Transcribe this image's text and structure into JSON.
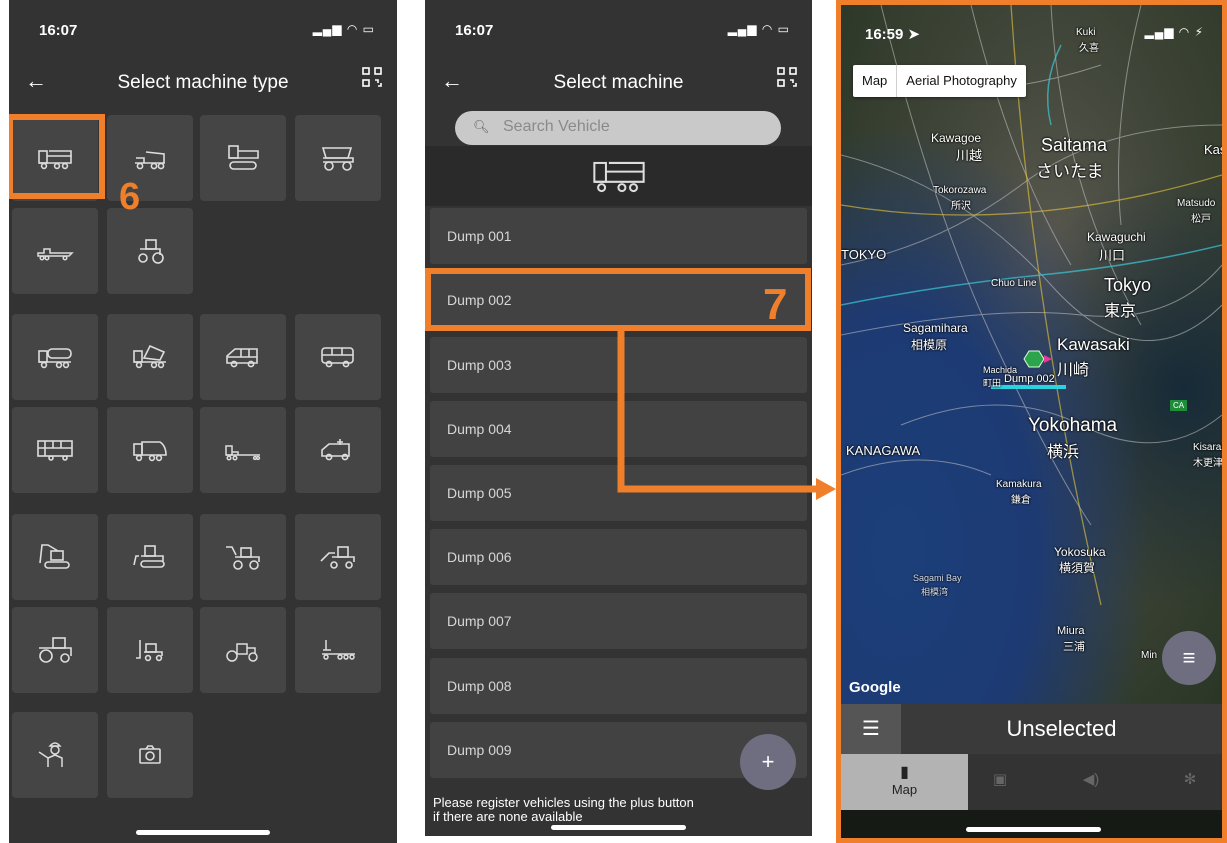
{
  "screen1": {
    "status_time": "16:07",
    "title": "Select machine type",
    "step_number": "6"
  },
  "screen2": {
    "status_time": "16:07",
    "title": "Select machine",
    "search_placeholder": "Search Vehicle",
    "vehicles": [
      "Dump 001",
      "Dump 002",
      "Dump 003",
      "Dump 004",
      "Dump 005",
      "Dump 006",
      "Dump 007",
      "Dump 008",
      "Dump 009"
    ],
    "add_label": "+",
    "note_line1": "Please register vehicles using the plus button",
    "note_line2": "if there are none available",
    "step_number": "7"
  },
  "screen3": {
    "status_time": "16:59",
    "map_buttons": [
      "Map",
      "Aerial Photography"
    ],
    "labels": {
      "kuki": "Kuki",
      "kuki_jp": "久喜",
      "kawagoe": "Kawagoe",
      "kawagoe_jp": "川越",
      "saitama": "Saitama",
      "saitama_jp": "さいたま",
      "kas": "Kas",
      "tokorozawa": "Tokorozawa",
      "tokorozawa_jp": "所沢",
      "matsudo": "Matsudo",
      "matsudo_jp": "松戸",
      "kawaguchi": "Kawaguchi",
      "kawaguchi_jp": "川口",
      "tokyo_edge": "TOKYO",
      "chuo": "Chuo Line",
      "tokyo": "Tokyo",
      "tokyo_jp": "東京",
      "sagamihara": "Sagamihara",
      "sagamihara_jp": "相模原",
      "kawasaki": "Kawasaki",
      "kawasaki_jp": "川崎",
      "machida": "Machida",
      "machida_jp": "町田",
      "marker": "Dump 002",
      "yokohama": "Yokohama",
      "yokohama_jp": "横浜",
      "kanagawa": "KANAGAWA",
      "kisarazu": "Kisaraz",
      "kisarazu_jp": "木更津",
      "kamakura": "Kamakura",
      "kamakura_jp": "鎌倉",
      "yokosuka": "Yokosuka",
      "yokosuka_jp": "横須賀",
      "sagami_bay": "Sagami Bay",
      "sagami_bay_jp": "相模湾",
      "miura": "Miura",
      "miura_jp": "三浦",
      "min": "Min",
      "ca": "CA"
    },
    "google": "Google",
    "selection": "Unselected",
    "tab_map": "Map"
  }
}
